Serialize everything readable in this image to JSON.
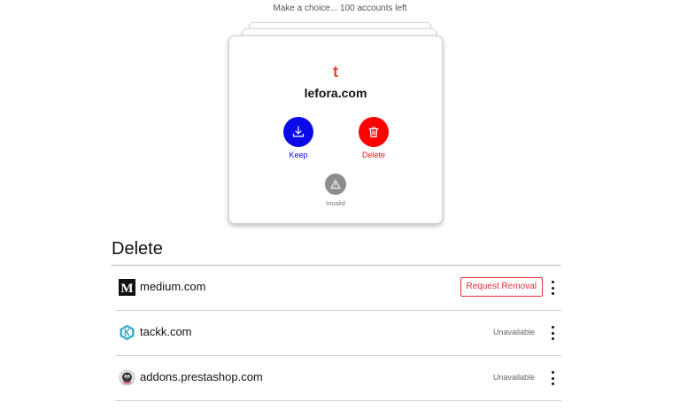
{
  "status": {
    "text": "Make a choice... 100 accounts left"
  },
  "card": {
    "logo_letter": "t",
    "logo_color": "#e8452c",
    "site": "lefora.com",
    "actions": {
      "keep": {
        "label": "Keep",
        "icon": "download-icon",
        "color": "#0a0ae8"
      },
      "delete": {
        "label": "Delete",
        "icon": "trash-icon",
        "color": "#ff0000"
      },
      "invalid": {
        "label": "Invalid",
        "icon": "warning-icon",
        "color": "#8e8e8e"
      }
    }
  },
  "delete_section": {
    "title": "Delete",
    "items": [
      {
        "name": "medium.com",
        "icon": "medium-logo-icon",
        "action_label": "Request Removal",
        "status": ""
      },
      {
        "name": "tackk.com",
        "icon": "tackk-logo-icon",
        "action_label": "",
        "status": "Unavailable"
      },
      {
        "name": "addons.prestashop.com",
        "icon": "prestashop-logo-icon",
        "action_label": "",
        "status": "Unavailable"
      }
    ]
  },
  "colors": {
    "accent_red": "#e0303a",
    "keep_blue": "#0a0ae8"
  }
}
